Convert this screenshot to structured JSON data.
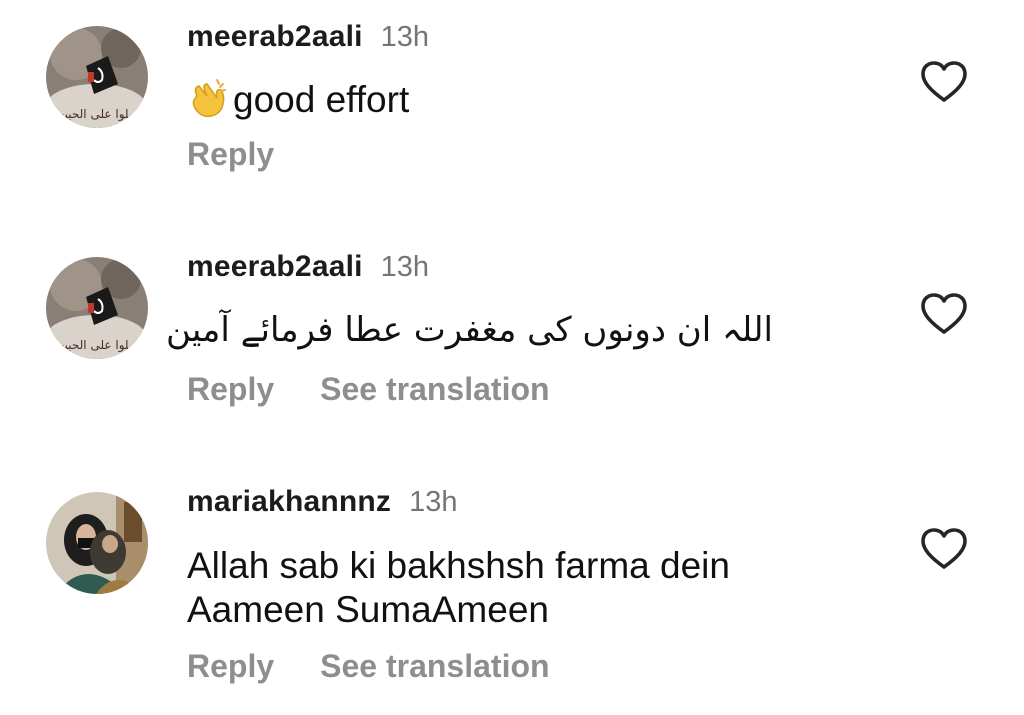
{
  "comments": [
    {
      "username": "meerab2aali",
      "time": "13h",
      "text": "good effort",
      "emoji": "clapping-hands-emoji",
      "avatar_caption": "صلوا على الحبيب",
      "reply_label": "Reply",
      "translation_label": ""
    },
    {
      "username": "meerab2aali",
      "time": "13h",
      "text": "اللہ ان دونوں کی مغفرت عطا فرمائے آمین",
      "avatar_caption": "صلوا على الحبيب",
      "reply_label": "Reply",
      "translation_label": "See translation"
    },
    {
      "username": "mariakhannnz",
      "time": "13h",
      "text_line1": "Allah sab ki bakhshsh farma dein",
      "text_line2": "Aameen SumaAmeen",
      "reply_label": "Reply",
      "translation_label": "See translation"
    }
  ],
  "icons": {
    "like": "heart-outline-icon"
  },
  "colors": {
    "username": "#1c1c1c",
    "time": "#757575",
    "action": "#8e8e8e",
    "heart": "#262626"
  }
}
